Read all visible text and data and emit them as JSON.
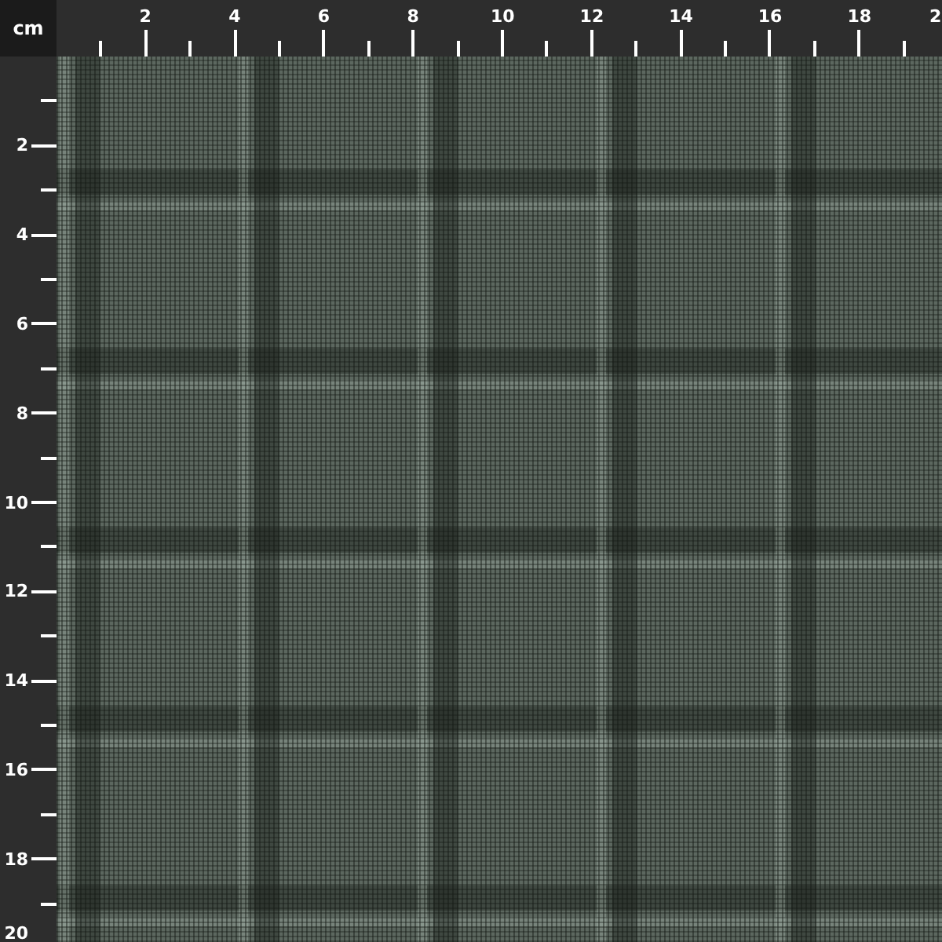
{
  "unit_label": "cm",
  "top_ruler": {
    "labels": [
      "2",
      "4",
      "6",
      "8",
      "10",
      "12",
      "14",
      "16",
      "18",
      "2"
    ]
  },
  "left_ruler": {
    "labels": [
      "2",
      "4",
      "6",
      "8",
      "10",
      "12",
      "14",
      "16",
      "18",
      "20"
    ]
  },
  "swatch": {
    "kind": "plaid"
  }
}
